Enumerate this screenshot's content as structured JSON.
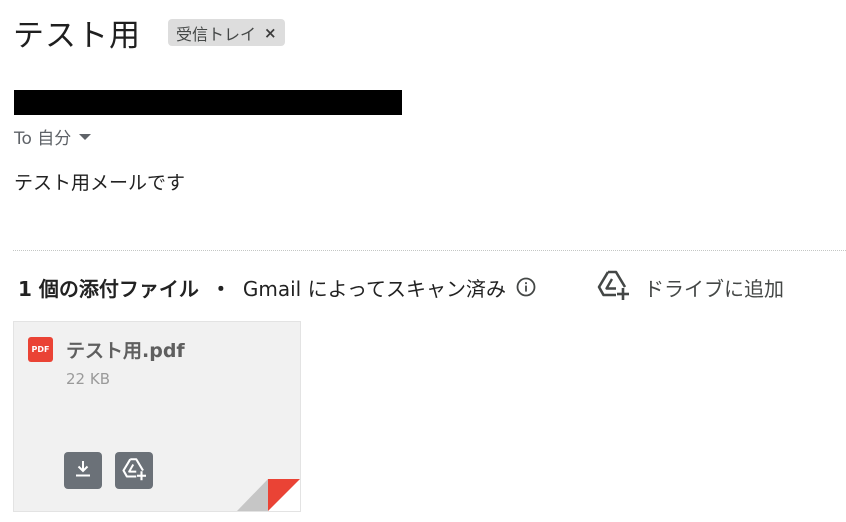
{
  "email": {
    "subject": "テスト用",
    "label": "受信トレイ",
    "label_remove": "×",
    "recipient": "To 自分",
    "body": "テスト用メールです"
  },
  "attachments_header": {
    "count_text": "1 個の添付ファイル",
    "separator": "・",
    "scan_text": "Gmail によってスキャン済み",
    "drive_label": "ドライブに追加"
  },
  "attachment": {
    "name": "テスト用.pdf",
    "size": "22 KB",
    "type_badge": "PDF"
  },
  "icons": {
    "info": "info-icon",
    "drive_add": "drive-add-icon",
    "download": "download-icon",
    "pdf": "pdf-icon"
  },
  "colors": {
    "pdf_red": "#ea4335",
    "button_gray": "#6b7178",
    "chip_bg": "#dddddd"
  }
}
